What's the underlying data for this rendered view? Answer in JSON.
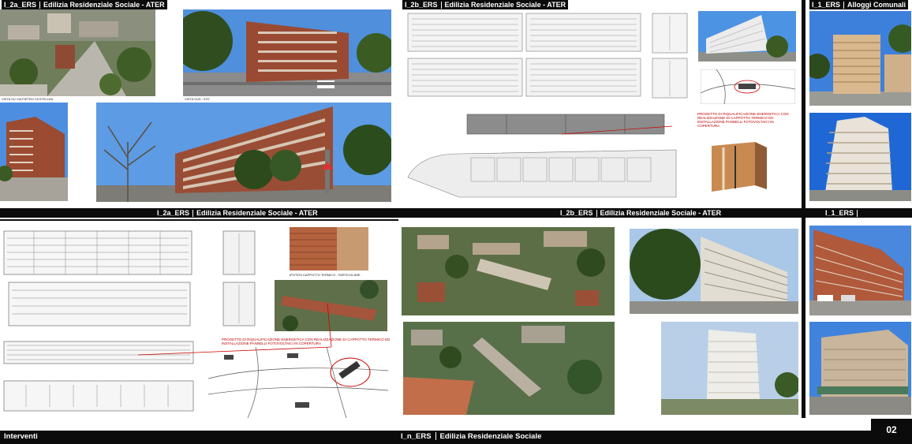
{
  "panels": {
    "i2a_top": {
      "code": "I_2a_ERS",
      "title": "Edilizia Residenziale Sociale - ATER"
    },
    "i2b_top": {
      "code": "I_2b_ERS",
      "title": "Edilizia Residenziale Sociale - ATER"
    },
    "i1_top": {
      "code": "I_1_ERS",
      "title": "Alloggi Comunali"
    },
    "i2a_mid": {
      "code": "I_2a_ERS",
      "title": "Edilizia Residenziale Sociale - ATER"
    },
    "i2b_mid": {
      "code": "I_2b_ERS",
      "title": "Edilizia Residenziale Sociale - ATER"
    },
    "i1_mid": {
      "code": "I_1_ERS"
    }
  },
  "captions": {
    "via_cestellini": "VISTA SU VIA PIETRO CESTELLINI",
    "vista_sud_est": "VISTA SUD - EST",
    "ipotesi_cappotto": "IPOTESI CAPPOTTO TERMICO - PARTICOLARE",
    "progetto_2a": "PROGETTO DI RIQUALIFICAZIONE ENERGETICA CON REALIZZAZIONE DI CAPPOTTO TERMICO ED INSTALLAZIONE PANNELLI FOTOVOLTAICI IN COPERTURA",
    "progetto_2b": "PROGETTO DI RIQUALIFICAZIONE ENERGETICA CON REALIZZAZIONE DI CAPPOTTO TERMICO ED INSTALLAZIONE PANNELLI FOTOVOLTAICI IN COPERTURA"
  },
  "footer": {
    "left": "Interventi",
    "code": "I_n_ERS",
    "title": "Edilizia Residenziale Sociale",
    "page": "02"
  },
  "colors": {
    "bar": "#0b0b0b",
    "brick": "#9a4a32",
    "sky": "#3f7fd6",
    "green": "#4b6b2e",
    "annotation": "#b00000"
  }
}
